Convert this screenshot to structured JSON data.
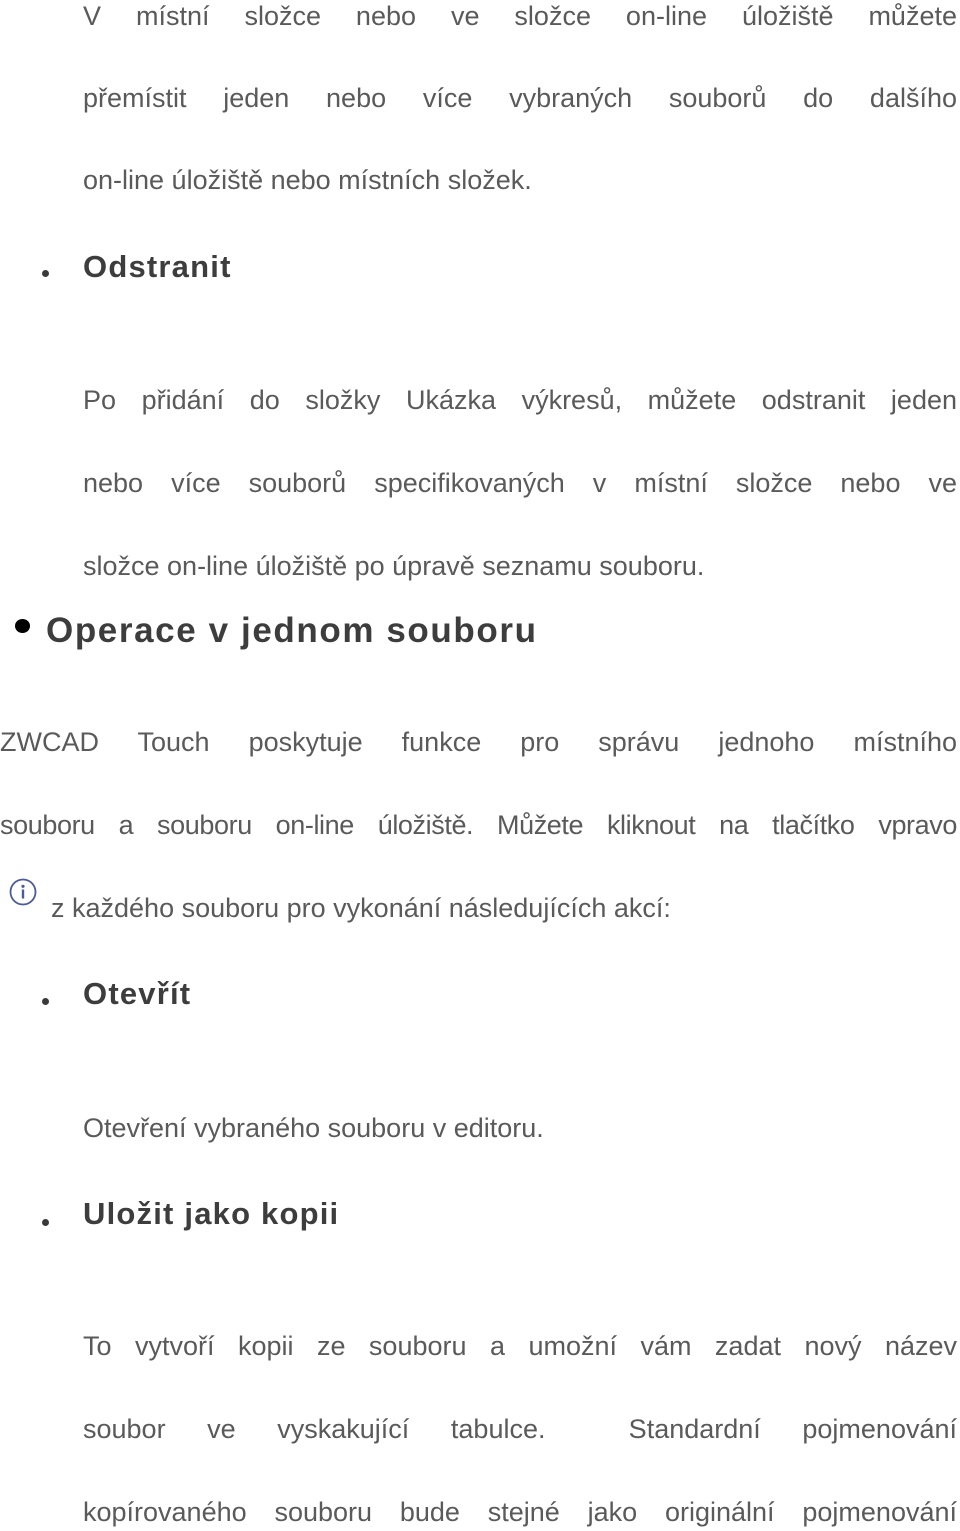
{
  "intro": {
    "lines": [
      "V místní složce nebo ve složce on-line úložiště můžete",
      "přemístit jeden nebo více vybraných souborů do dalšího",
      "on-line úložiště nebo místních složek."
    ]
  },
  "odstranit": {
    "heading": "Odstranit",
    "lines": [
      "Po přidání do složky Ukázka výkresů, můžete odstranit jeden",
      "nebo více souborů specifikovaných v místní složce nebo ve",
      "složce on-line úložiště po úpravě seznamu souboru."
    ]
  },
  "section": {
    "heading": "Operace v jednom souboru",
    "lines": [
      "ZWCAD Touch poskytuje funkce pro správu jednoho místního",
      "souboru a souboru on-line úložiště. Můžete kliknout na tlačítko vpravo",
      "z každého souboru pro vykonání následujících akcí:"
    ],
    "icon": "info-icon",
    "icon_color": "#4a5a9a"
  },
  "otevrit": {
    "heading": "Otevřít",
    "lines": [
      "Otevření vybraného souboru v editoru."
    ]
  },
  "ulozit": {
    "heading": "Uložit jako kopii",
    "lines": [
      "To vytvoří kopii ze souboru a umožní vám zadat nový název",
      "soubor ve vyskakující tabulce.  Standardní pojmenování",
      "kopírovaného souboru bude stejné jako originální pojmenování"
    ]
  }
}
